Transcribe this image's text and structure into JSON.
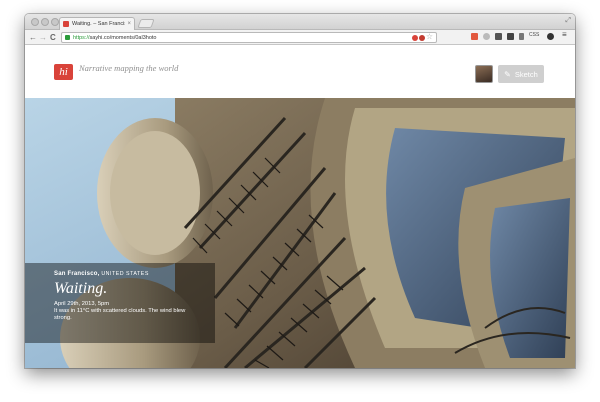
{
  "browser": {
    "tab_title": "Waiting. – San Francisco, ...",
    "tab_close": "×",
    "url_scheme": "https://",
    "url_rest": "sayhi.co/moments/0al3hoto",
    "nav_back": "←",
    "nav_forward": "→",
    "nav_reload": "C",
    "star": "☆",
    "css_ext_label": "CSS",
    "menu": "≡",
    "fullscreen": "⤢"
  },
  "site": {
    "logo_text": "hi",
    "tagline": "Narrative mapping the world",
    "sketch_label": "Sketch",
    "pencil": "✎"
  },
  "moment": {
    "city": "San Francisco,",
    "country": "UNITED STATES",
    "title": "Waiting.",
    "date": "April 29th, 2013, 5pm",
    "description": "It was in 11°C with scattered clouds. The wind blew strong."
  },
  "colors": {
    "brand": "#d9433a",
    "secure_green": "#2a9b3a"
  }
}
